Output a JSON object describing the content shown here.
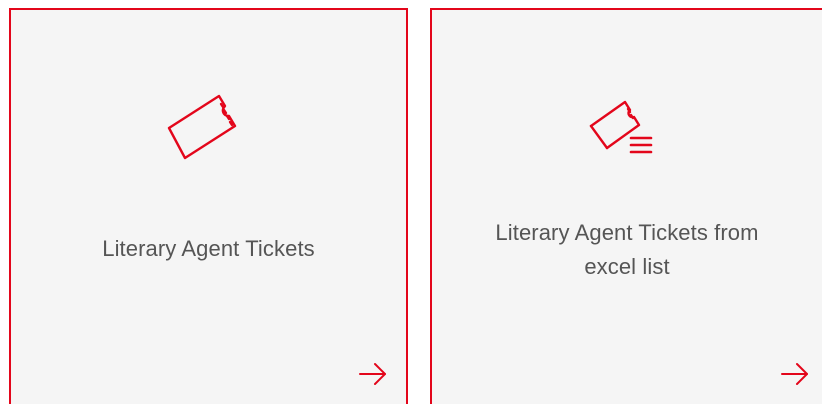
{
  "cards": [
    {
      "label": "Literary Agent Tickets",
      "icon": "ticket-icon",
      "action_icon": "arrow-right-icon"
    },
    {
      "label": "Literary Agent Tickets from excel list",
      "icon": "ticket-list-icon",
      "action_icon": "arrow-right-icon"
    }
  ],
  "colors": {
    "accent": "#e3061b",
    "card_background": "#f5f5f5",
    "text": "#555555"
  }
}
